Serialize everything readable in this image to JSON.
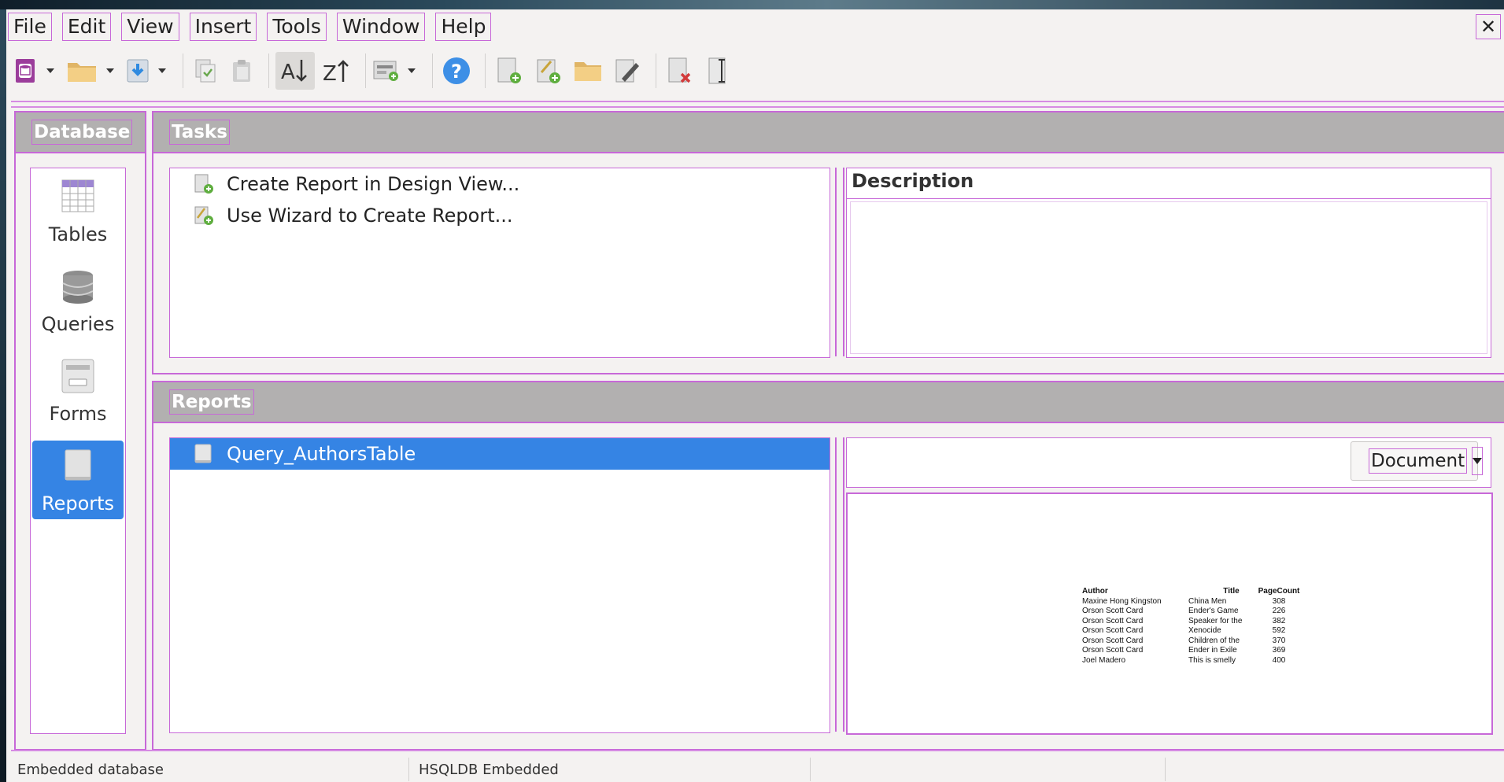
{
  "menubar": {
    "items": [
      "File",
      "Edit",
      "View",
      "Insert",
      "Tools",
      "Window",
      "Help"
    ],
    "close_glyph": "✕"
  },
  "toolbar": {
    "buttons": [
      "new-database-icon",
      "open-folder-icon",
      "save-icon",
      "copy-icon",
      "paste-icon",
      "sort-ascending-icon",
      "sort-descending-icon",
      "form-icon",
      "help-icon",
      "new-report-icon",
      "wizard-icon",
      "open-report-icon",
      "edit-report-icon",
      "delete-report-icon",
      "rename-icon"
    ]
  },
  "database_panel": {
    "title": "Database",
    "items": [
      {
        "label": "Tables",
        "icon": "tables-icon"
      },
      {
        "label": "Queries",
        "icon": "queries-icon"
      },
      {
        "label": "Forms",
        "icon": "forms-icon"
      },
      {
        "label": "Reports",
        "icon": "reports-icon",
        "selected": true
      }
    ]
  },
  "tasks": {
    "title": "Tasks",
    "items": [
      "Create Report in Design View...",
      "Use Wizard to Create Report..."
    ],
    "description_title": "Description"
  },
  "reports": {
    "title": "Reports",
    "items": [
      "Query_AuthorsTable"
    ],
    "preview_mode": "Document",
    "preview_table": {
      "headers": [
        "Author",
        "Title",
        "PageCount"
      ],
      "rows": [
        [
          "Maxine Hong Kingston",
          "China Men",
          "308"
        ],
        [
          "Orson Scott Card",
          "Ender's Game",
          "226"
        ],
        [
          "Orson Scott Card",
          "Speaker for the",
          "382"
        ],
        [
          "Orson Scott Card",
          "Xenocide",
          "592"
        ],
        [
          "Orson Scott Card",
          "Children of the",
          "370"
        ],
        [
          "Orson Scott Card",
          "Ender in Exile",
          "369"
        ],
        [
          "Joel Madero",
          "This is smelly",
          "400"
        ]
      ]
    }
  },
  "statusbar": {
    "left": "Embedded database",
    "middle": "HSQLDB Embedded"
  },
  "colors": {
    "selection": "#3584e4",
    "panel_header": "#b2b0b0",
    "outline": "#c768d8"
  }
}
